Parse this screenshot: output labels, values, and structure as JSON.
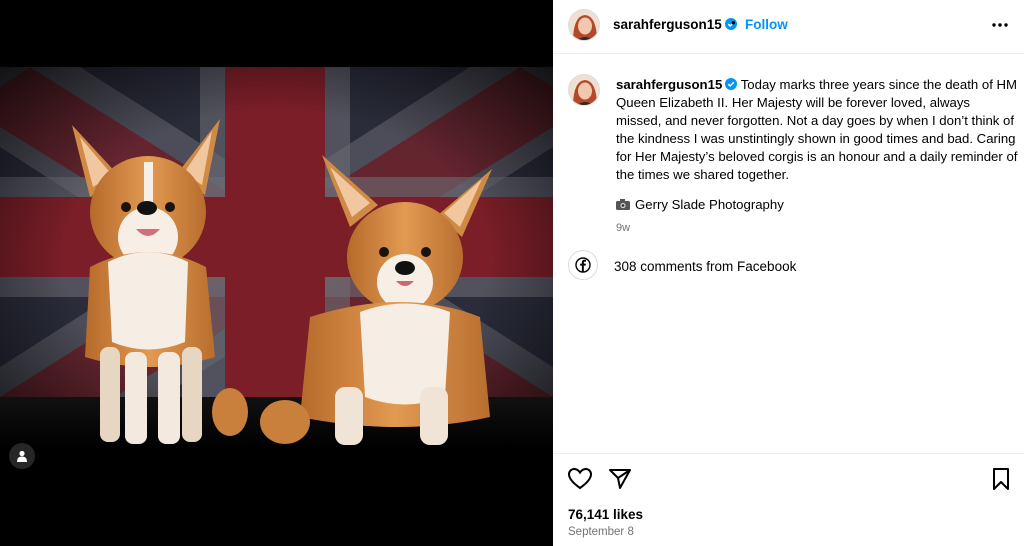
{
  "post": {
    "username": "sarahferguson15",
    "follow_label": "Follow",
    "separator": "•",
    "caption_username": "sarahferguson15",
    "caption_text": " Today marks three years since the death of HM Queen Elizabeth II. Her Majesty will be forever loved, always missed, and never forgotten. Not a day goes by when I don’t think of the kindness I was unstintingly shown in good times and bad. Caring for Her Majesty’s beloved corgis is an honour and a daily reminder of the times we shared together.",
    "photo_credit": "Gerry Slade Photography",
    "age": "9w",
    "comments_label": "308 comments from Facebook",
    "likes": "76,141 likes",
    "date": "September 8"
  },
  "icons": {
    "verified": "verified-badge-icon",
    "more": "more-options-icon",
    "camera": "camera-icon",
    "facebook": "facebook-icon",
    "like": "heart-icon",
    "share": "share-icon",
    "save": "bookmark-icon",
    "tag": "user-tag-icon"
  },
  "colors": {
    "accent": "#0095f6",
    "secondary_text": "#737373",
    "divider": "#efefef"
  }
}
